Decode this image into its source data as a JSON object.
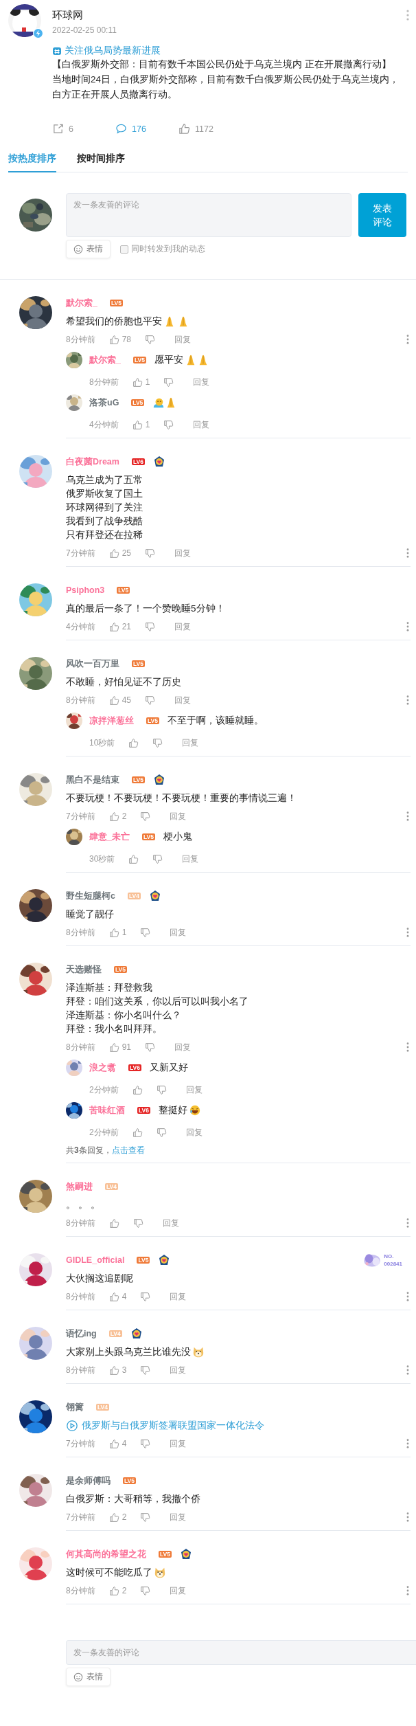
{
  "post": {
    "author": "环球网",
    "date": "2022-02-25 00:11",
    "topic": "关注俄乌局势最新进展",
    "headline": "【白俄罗斯外交部：目前有数千本国公民仍处于乌克兰境内 正在开展撤离行动】",
    "body": "当地时间24日，白俄罗斯外交部称，目前有数千白俄罗斯公民仍处于乌克兰境内，白方正在开展人员撤离行动。",
    "stats": [
      {
        "kind": "share",
        "count": "6",
        "active": false
      },
      {
        "kind": "comment",
        "count": "176",
        "active": true
      },
      {
        "kind": "like",
        "count": "1172",
        "active": false
      }
    ]
  },
  "tabs": [
    {
      "label": "按热度排序",
      "selected": true
    },
    {
      "label": "按时间排序",
      "selected": false
    }
  ],
  "composer": {
    "placeholder": "发一条友善的评论",
    "submit": "发表评论",
    "emoji": "表情",
    "forward": {
      "label": "同时转发到我的动态",
      "checked": false
    }
  },
  "comments": [
    {
      "name": "默尔索_",
      "vip": true,
      "level": {
        "text": "LV5",
        "color": "#ef7a38"
      },
      "medal": false,
      "kind": "text",
      "lines": [
        "希望我们的侨胞也平安"
      ],
      "emojis": [
        {
          "kind": "pray"
        },
        {
          "kind": "pray"
        }
      ],
      "time": "8分钟前",
      "likes": "78",
      "reply_label": "回复",
      "replies": [
        {
          "name": "默尔索_",
          "vip": true,
          "level": {
            "text": "LV5",
            "color": "#ef7a38"
          },
          "text": "愿平安",
          "emojis": [
            {
              "kind": "pray"
            },
            {
              "kind": "pray"
            }
          ],
          "time": "8分钟前",
          "likes": "1",
          "reply_label": "回复"
        },
        {
          "name": "洛茶uG",
          "vip": false,
          "level": {
            "text": "LV5",
            "color": "#ef7a38"
          },
          "emojis": [
            {
              "kind": "hug"
            },
            {
              "kind": "pray"
            }
          ],
          "time": "4分钟前",
          "likes": "1",
          "reply_label": "回复"
        }
      ]
    },
    {
      "name": "白夜菌Dream",
      "vip": true,
      "level": {
        "text": "LV6",
        "color": "#e52525"
      },
      "medal": true,
      "kind": "text",
      "lines": [
        "乌克兰成为了五常",
        "俄罗斯收复了国土",
        "环球网得到了关注",
        "我看到了战争残酷",
        "只有拜登还在拉稀"
      ],
      "time": "7分钟前",
      "likes": "25",
      "reply_label": "回复"
    },
    {
      "name": "Psiphon3",
      "vip": true,
      "level": {
        "text": "LV5",
        "color": "#ef7a38"
      },
      "medal": false,
      "kind": "text",
      "lines": [
        "真的最后一条了！一个赞晚睡5分钟！"
      ],
      "time": "4分钟前",
      "likes": "21",
      "reply_label": "回复"
    },
    {
      "name": "风吹一百万里",
      "vip": false,
      "level": {
        "text": "LV5",
        "color": "#ef7a38"
      },
      "medal": false,
      "kind": "text",
      "lines": [
        "不敢睡，好怕见证不了历史"
      ],
      "time": "8分钟前",
      "likes": "45",
      "reply_label": "回复",
      "replies": [
        {
          "name": "凉拌洋葱丝",
          "vip": true,
          "level": {
            "text": "LV5",
            "color": "#ef7a38"
          },
          "text": "不至于啊，该睡就睡。",
          "time": "10秒前",
          "reply_label": "回复"
        }
      ]
    },
    {
      "name": "黑白不是结束",
      "vip": false,
      "level": {
        "text": "LV5",
        "color": "#ef7a38"
      },
      "medal": true,
      "kind": "text",
      "lines": [
        "不要玩梗！不要玩梗！不要玩梗！重要的事情说三遍！"
      ],
      "time": "7分钟前",
      "likes": "2",
      "reply_label": "回复",
      "replies": [
        {
          "name": "肆意_未亡",
          "vip": true,
          "level": {
            "text": "LV5",
            "color": "#ef7a38"
          },
          "text": "梗小鬼",
          "time": "30秒前",
          "reply_label": "回复"
        }
      ]
    },
    {
      "name": "野生短腿柯c",
      "vip": false,
      "level": {
        "text": "LV4",
        "color": "#f8c096"
      },
      "medal": true,
      "kind": "text",
      "lines": [
        "睡觉了靓仔"
      ],
      "time": "8分钟前",
      "likes": "1",
      "reply_label": "回复"
    },
    {
      "name": "天选赌怪",
      "vip": false,
      "level": {
        "text": "LV5",
        "color": "#ef7a38"
      },
      "medal": false,
      "kind": "text",
      "lines": [
        "泽连斯基：拜登救我",
        "拜登：咱们这关系，你以后可以叫我小名了",
        "泽连斯基：你小名叫什么？",
        "拜登：我小名叫拜拜。"
      ],
      "time": "8分钟前",
      "likes": "91",
      "reply_label": "回复",
      "replies": [
        {
          "name": "浪之翥",
          "vip": true,
          "level": {
            "text": "LV6",
            "color": "#e52525"
          },
          "text": "又新又好",
          "time": "2分钟前",
          "reply_label": "回复"
        },
        {
          "name": "苦味红酒",
          "vip": true,
          "level": {
            "text": "LV6",
            "color": "#e52525"
          },
          "text": "整挺好",
          "emojis": [
            {
              "kind": "laugh"
            }
          ],
          "time": "2分钟前",
          "reply_label": "回复"
        }
      ],
      "more": {
        "summary": "共**3**条回复，",
        "link": "点击查看"
      }
    },
    {
      "name": "煞嗣进",
      "vip": true,
      "level": {
        "text": "LV4",
        "color": "#f8c096"
      },
      "medal": false,
      "kind": "text",
      "lines": [
        "。 。 。"
      ],
      "time": "8分钟前",
      "reply_label": "回复"
    },
    {
      "name": "GIDLE_official",
      "vip": true,
      "level": {
        "text": "LV5",
        "color": "#ef7a38"
      },
      "medal": true,
      "kind": "text",
      "lines": [
        "大伙搁这追剧呢"
      ],
      "time": "8分钟前",
      "likes": "4",
      "reply_label": "回复",
      "decoration": {
        "label": "NO.",
        "number": "002841"
      }
    },
    {
      "name": "语忆ing",
      "vip": false,
      "level": {
        "text": "LV4",
        "color": "#f8c096"
      },
      "medal": true,
      "kind": "text",
      "lines": [
        "大家别上头跟乌克兰比谁先没"
      ],
      "emojis": [
        {
          "kind": "dog"
        }
      ],
      "time": "8分钟前",
      "likes": "3",
      "reply_label": "回复"
    },
    {
      "name": "翎篱",
      "vip": false,
      "level": {
        "text": "LV4",
        "color": "#f8c096"
      },
      "medal": false,
      "kind": "video_link",
      "lines": [
        "俄罗斯与白俄罗斯签署联盟国家一体化法令"
      ],
      "time": "7分钟前",
      "likes": "4",
      "reply_label": "回复"
    },
    {
      "name": "是余师傅吗",
      "vip": false,
      "level": {
        "text": "LV5",
        "color": "#ef7a38"
      },
      "medal": false,
      "kind": "text",
      "lines": [
        "白俄罗斯：大哥稍等，我撤个侨"
      ],
      "time": "7分钟前",
      "likes": "2",
      "reply_label": "回复"
    },
    {
      "name": "何其高尚的希望之花",
      "vip": true,
      "level": {
        "text": "LV5",
        "color": "#ef7a38"
      },
      "medal": true,
      "kind": "text",
      "lines": [
        "这时候可不能吃瓜了"
      ],
      "emojis": [
        {
          "kind": "dog"
        }
      ],
      "time": "8分钟前",
      "likes": "2",
      "reply_label": "回复"
    }
  ],
  "bottom_composer": {
    "placeholder": "发一条友善的评论",
    "emoji": "表情"
  }
}
